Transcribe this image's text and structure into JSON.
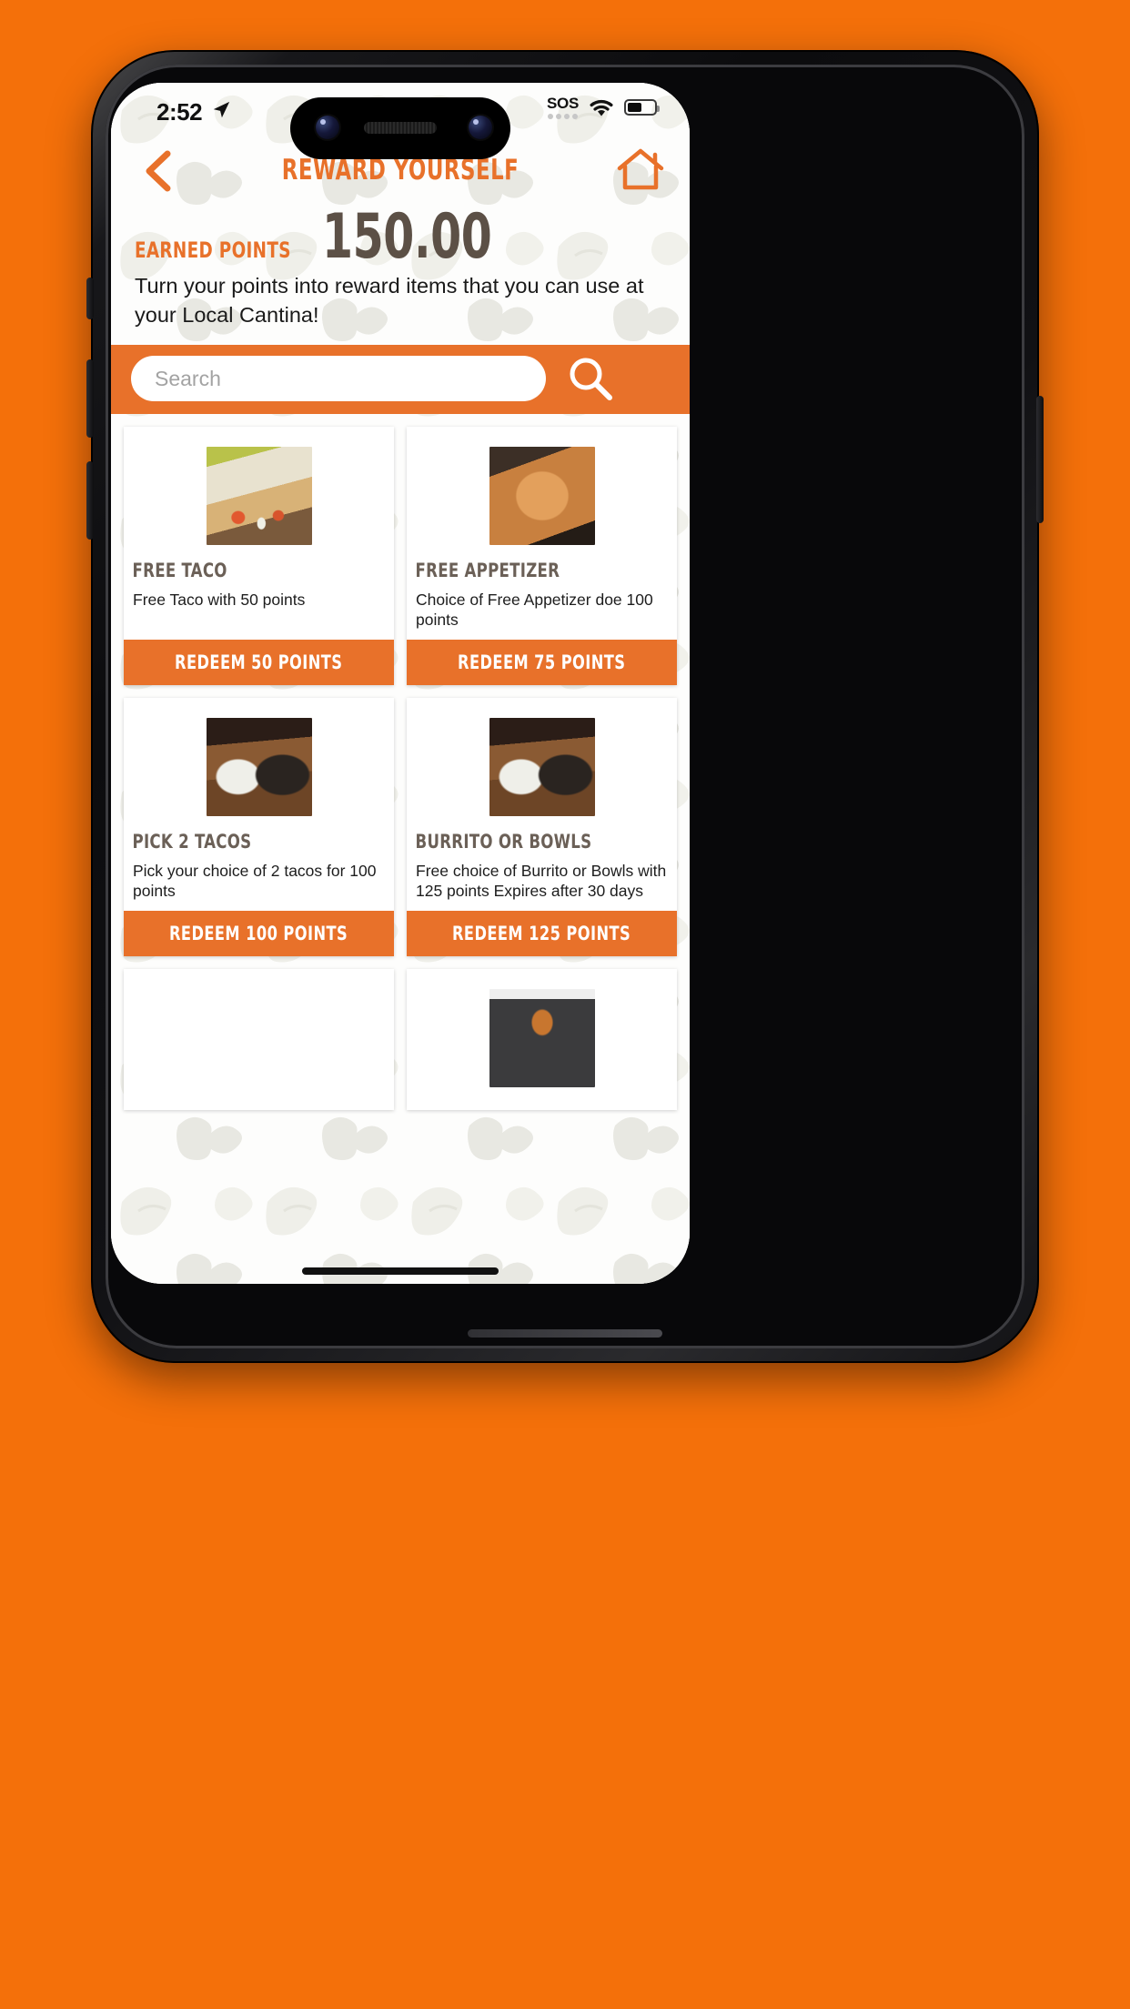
{
  "status_bar": {
    "time": "2:52",
    "location_icon": "location-arrow-icon",
    "sos_label": "SOS",
    "wifi_icon": "wifi-icon",
    "battery_icon": "battery-icon",
    "battery_level_percent": 52
  },
  "header": {
    "back_icon": "back-chevron-icon",
    "title": "REWARD YOURSELF",
    "home_icon": "home-icon"
  },
  "points": {
    "label": "EARNED POINTS",
    "value": "150.00",
    "description": "Turn your points into reward items that you can use at your Local Cantina!"
  },
  "search": {
    "placeholder": "Search",
    "value": "",
    "search_icon": "search-icon"
  },
  "rewards": [
    {
      "title": "FREE TACO",
      "description": "Free Taco with 50 points",
      "redeem_label": "REDEEM 50 POINTS",
      "image": "taco-photo",
      "image_class": "img-taco"
    },
    {
      "title": "FREE APPETIZER",
      "description": "Choice of Free Appetizer doe 100 points",
      "redeem_label": "REDEEM 75 POINTS",
      "image": "appetizer-photo",
      "image_class": "img-appetizer"
    },
    {
      "title": "PICK 2 TACOS",
      "description": "Pick your choice of 2 tacos for 100 points",
      "redeem_label": "REDEEM 100 POINTS",
      "image": "burrito-bowl-photo",
      "image_class": "img-burrito"
    },
    {
      "title": "BURRITO OR BOWLS",
      "description": "Free choice of Burrito or Bowls with 125 points\nExpires after 30 days",
      "redeem_label": "REDEEM 125 POINTS",
      "image": "burrito-bowl-photo",
      "image_class": "img-burrito"
    },
    {
      "title": "",
      "description": "",
      "redeem_label": "",
      "image": "nachos-photo",
      "image_class": "img-nachos"
    },
    {
      "title": "",
      "description": "",
      "redeem_label": "",
      "image": "tshirt-photo",
      "image_class": "img-shirt"
    }
  ],
  "colors": {
    "brand_orange": "#E8712A",
    "page_background": "#F4700A",
    "points_brown": "#5C5046",
    "title_brown": "#6B6057"
  }
}
